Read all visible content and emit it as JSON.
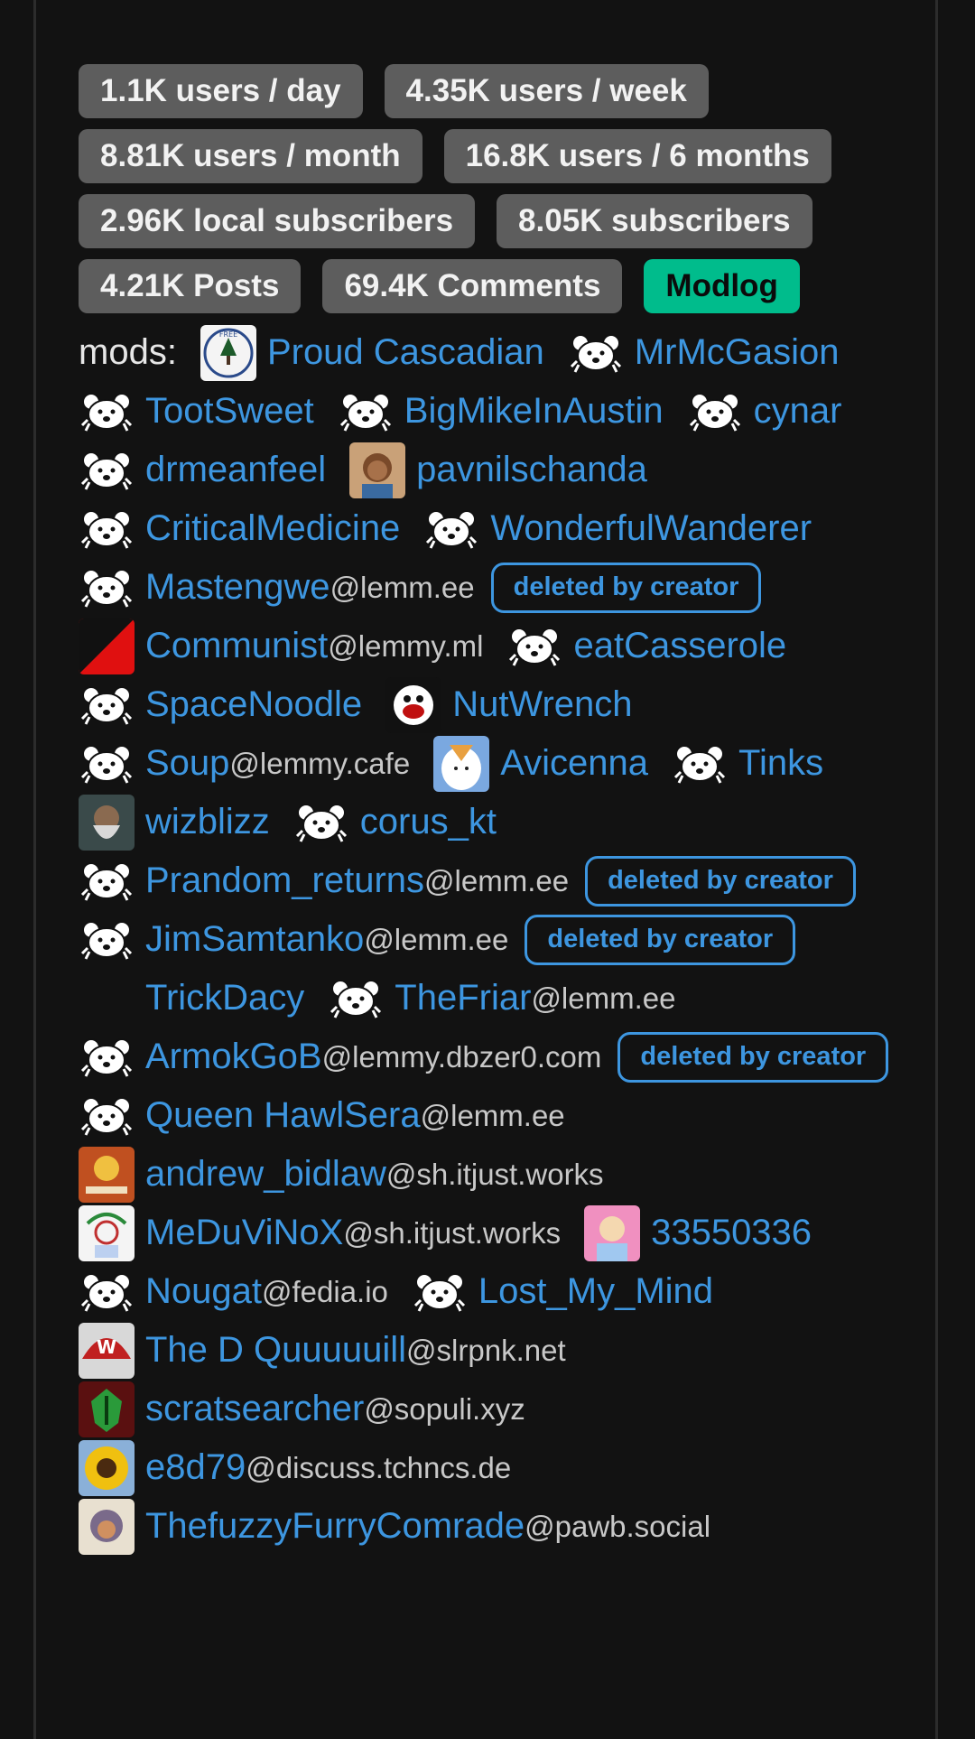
{
  "stats": {
    "row1": [
      "1.1K users / day",
      "4.35K users / week"
    ],
    "row2": [
      "8.81K users / month",
      "16.8K users / 6 months"
    ],
    "row3": [
      "2.96K local subscribers",
      "8.05K subscribers"
    ],
    "row4": [
      "4.21K Posts",
      "69.4K Comments"
    ],
    "modlog": "Modlog"
  },
  "mods_label": "mods:",
  "mods": [
    {
      "name": "Proud Cascadian",
      "instance": "",
      "avatar": "cascadia-avatar"
    },
    {
      "name": "MrMcGasion",
      "instance": "",
      "avatar": "default-icon"
    },
    {
      "name": "TootSweet",
      "instance": "",
      "avatar": "default-icon"
    },
    {
      "name": "BigMikeInAustin",
      "instance": "",
      "avatar": "default-icon"
    },
    {
      "name": "cynar",
      "instance": "",
      "avatar": "default-icon"
    },
    {
      "name": "drmeanfeel",
      "instance": "",
      "avatar": "default-icon"
    },
    {
      "name": "pavnilschanda",
      "instance": "",
      "avatar": "portrait-avatar"
    },
    {
      "name": "CriticalMedicine",
      "instance": "",
      "avatar": "default-icon"
    },
    {
      "name": "WonderfulWanderer",
      "instance": "",
      "avatar": "default-icon"
    },
    {
      "name": "Mastengwe",
      "instance": "@lemm.ee",
      "avatar": "default-icon",
      "deleted": "deleted by creator"
    },
    {
      "name": "Communist",
      "instance": "@lemmy.ml",
      "avatar": "red-flag-avatar"
    },
    {
      "name": "eatCasserole",
      "instance": "",
      "avatar": "default-icon"
    },
    {
      "name": "SpaceNoodle",
      "instance": "",
      "avatar": "default-icon"
    },
    {
      "name": "NutWrench",
      "instance": "",
      "avatar": "troll-avatar"
    },
    {
      "name": "Soup",
      "instance": "@lemmy.cafe",
      "avatar": "default-icon"
    },
    {
      "name": "Avicenna",
      "instance": "",
      "avatar": "bird-avatar"
    },
    {
      "name": "Tinks",
      "instance": "",
      "avatar": "default-icon"
    },
    {
      "name": "wizblizz",
      "instance": "",
      "avatar": "wizard-avatar"
    },
    {
      "name": "corus_kt",
      "instance": "",
      "avatar": "default-icon"
    },
    {
      "name": "Prandom_returns",
      "instance": "@lemm.ee",
      "avatar": "default-icon",
      "deleted": "deleted by creator"
    },
    {
      "name": "JimSamtanko",
      "instance": "@lemm.ee",
      "avatar": "default-icon",
      "deleted": "deleted by creator"
    },
    {
      "name": "TrickDacy",
      "instance": "",
      "avatar": "none"
    },
    {
      "name": "TheFriar",
      "instance": "@lemm.ee",
      "avatar": "default-icon"
    },
    {
      "name": "ArmokGoB",
      "instance": "@lemmy.dbzer0.com",
      "avatar": "default-icon",
      "deleted": "deleted by creator"
    },
    {
      "name": "Queen HawlSera",
      "instance": "@lemm.ee",
      "avatar": "default-icon"
    },
    {
      "name": "andrew_bidlaw",
      "instance": "@sh.itjust.works",
      "avatar": "cartoon-avatar"
    },
    {
      "name": "MeDuViNoX",
      "instance": "@sh.itjust.works",
      "avatar": "sketch-avatar"
    },
    {
      "name": "33550336",
      "instance": "",
      "avatar": "pink-avatar"
    },
    {
      "name": "Nougat",
      "instance": "@fedia.io",
      "avatar": "default-icon"
    },
    {
      "name": "Lost_My_Mind",
      "instance": "",
      "avatar": "default-icon"
    },
    {
      "name": "The D Quuuuuill",
      "instance": "@slrpnk.net",
      "avatar": "w-cap-avatar"
    },
    {
      "name": "scratsearcher",
      "instance": "@sopuli.xyz",
      "avatar": "green-emblem-avatar"
    },
    {
      "name": "e8d79",
      "instance": "@discuss.tchncs.de",
      "avatar": "sunflower-avatar"
    },
    {
      "name": "ThefuzzyFurryComrade",
      "instance": "@pawb.social",
      "avatar": "fox-avatar"
    }
  ],
  "colors": {
    "background": "#121212",
    "badge": "#5d5d5d",
    "modlog": "#00bc8c",
    "link": "#3d96e0",
    "instance": "#c8c8c8"
  }
}
